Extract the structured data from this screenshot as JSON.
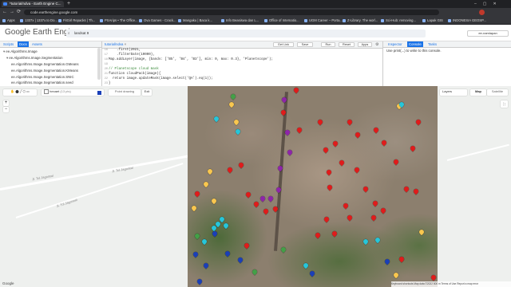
{
  "browser": {
    "tabs": [
      {
        "label": "*tutorial/ndva - Earth Engine C...",
        "active": true
      },
      {
        "label": "",
        "active": false
      }
    ],
    "url": "code.earthengine.google.com",
    "bookmarks": [
      "Apps",
      "1337x | 1337x.to Do...",
      "FitGirl Repacks | Th...",
      "PSArips • The Office...",
      "Ova Games - Crack...",
      "Mangaku | Baca k...",
      "Info Beasiswa dan L...",
      "Office of Internatio...",
      "UGM Career – Porta...",
      "Z-Library. The worl...",
      "Sci-Hub: removing...",
      "Lapak GIS",
      "INDONESIA GEOSP..."
    ]
  },
  "gee": {
    "logo": "Google Earth Engine",
    "search_value": "landsat 9",
    "user": "ee-namlapan"
  },
  "left_panel": {
    "tabs": [
      "Scripts",
      "Docs",
      "Assets"
    ],
    "selected_tab": "Docs",
    "tree": [
      "ee.Algorithms.Image",
      "ee.Algorithms.Image.Segmentation",
      "ee.Algorithms.Image.Segmentation.GMeans",
      "ee.Algorithms.Image.Segmentation.KMeans",
      "ee.Algorithms.Image.Segmentation.SNIC",
      "ee.Algorithms.Image.Segmentation.seed"
    ]
  },
  "editor": {
    "file_tab": "tutorial/ndva",
    "buttons": [
      "Get Link",
      "Save",
      "Run",
      "Reset",
      "Apps"
    ],
    "lines": [
      "    .first(2021,",
      "    .filterDate(10000),",
      "Map.addLayer(image, {bands: ['B5', 'B4', 'B3'], min: 0, max: 0.3}, 'Planetscope');",
      "",
      "// Planetscope cloud mask",
      "function cloudPack(image){",
      "  return image.updateMask(image.select('QA').eq(1));",
      "}"
    ],
    "line_numbers": [
      "16",
      "17",
      "18",
      "19",
      "20",
      "21",
      "22",
      "23"
    ]
  },
  "console": {
    "tabs": [
      "Inspector",
      "Console",
      "Tasks"
    ],
    "selected_tab": "Console",
    "hint": "Use print(...) to write to this console."
  },
  "map": {
    "geometry_label": "Geometry Imports",
    "layer_name": "hexaet",
    "layer_count": "(13 pts)",
    "point_label": "Point drawing",
    "exit_label": "Exit",
    "layers_label": "Layers",
    "map_type_options": [
      "Map",
      "Satellite"
    ],
    "selected_map_type": "Map",
    "attribution": "Keyboard shortcuts  Map data ©2022  500 m  Terms of Use  Report a map error",
    "pin_colors": {
      "red": "#e01b1b",
      "purple": "#8e24aa",
      "cyan": "#26c6da",
      "yellow": "#f9c74f",
      "green": "#43a047",
      "blue": "#1a3fb8"
    },
    "road_labels": [
      "Jl. Tol Jagorawi",
      "Jl. Tol Jagorawi",
      "Jl. Tol Jagorawi"
    ]
  }
}
